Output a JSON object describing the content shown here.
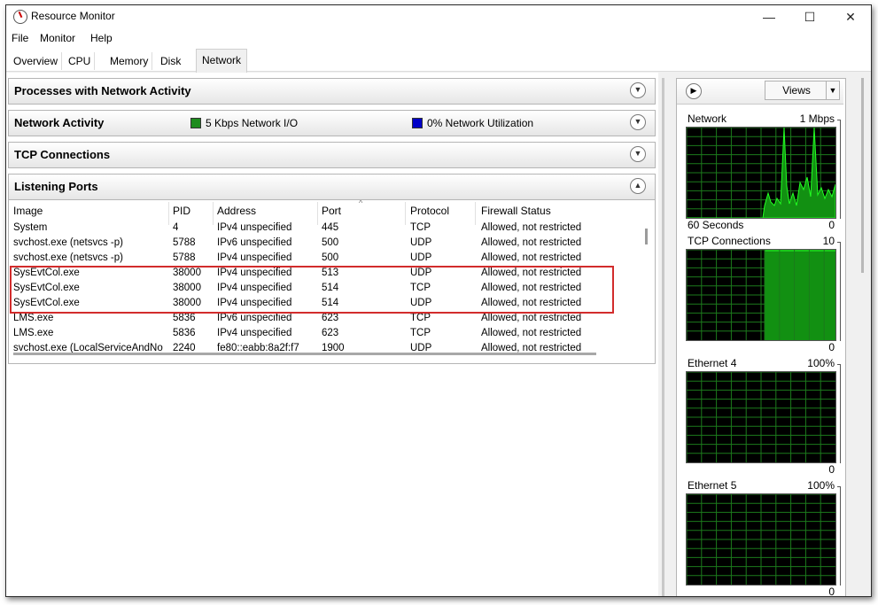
{
  "window": {
    "title": "Resource Monitor",
    "minimize": "—",
    "maximize": "☐",
    "close": "✕"
  },
  "menu": [
    "File",
    "Monitor",
    "Help"
  ],
  "tabs": [
    "Overview",
    "CPU",
    "Memory",
    "Disk",
    "Network"
  ],
  "active_tab": "Network",
  "sections": {
    "processes": {
      "title": "Processes with Network Activity"
    },
    "network_activity": {
      "title": "Network Activity",
      "io_label": "5 Kbps Network I/O",
      "io_color": "#1e8c1e",
      "util_label": "0% Network Utilization",
      "util_color": "#0000c8"
    },
    "tcp": {
      "title": "TCP Connections"
    },
    "listening": {
      "title": "Listening Ports"
    }
  },
  "listening_ports": {
    "columns": [
      "Image",
      "PID",
      "Address",
      "Port",
      "Protocol",
      "Firewall Status"
    ],
    "rows": [
      [
        "System",
        "4",
        "IPv4 unspecified",
        "445",
        "TCP",
        "Allowed, not restricted"
      ],
      [
        "svchost.exe (netsvcs -p)",
        "5788",
        "IPv6 unspecified",
        "500",
        "UDP",
        "Allowed, not restricted"
      ],
      [
        "svchost.exe (netsvcs -p)",
        "5788",
        "IPv4 unspecified",
        "500",
        "UDP",
        "Allowed, not restricted"
      ],
      [
        "SysEvtCol.exe",
        "38000",
        "IPv4 unspecified",
        "513",
        "UDP",
        "Allowed, not restricted"
      ],
      [
        "SysEvtCol.exe",
        "38000",
        "IPv4 unspecified",
        "514",
        "TCP",
        "Allowed, not restricted"
      ],
      [
        "SysEvtCol.exe",
        "38000",
        "IPv4 unspecified",
        "514",
        "UDP",
        "Allowed, not restricted"
      ],
      [
        "LMS.exe",
        "5836",
        "IPv6 unspecified",
        "623",
        "TCP",
        "Allowed, not restricted"
      ],
      [
        "LMS.exe",
        "5836",
        "IPv4 unspecified",
        "623",
        "TCP",
        "Allowed, not restricted"
      ],
      [
        "svchost.exe (LocalServiceAndNo",
        "2240",
        "fe80::eabb:8a2f:f7",
        "1900",
        "UDP",
        "Allowed, not restricted"
      ]
    ],
    "highlight_color": "#d22c2c"
  },
  "views_panel": {
    "views_label": "Views",
    "graphs": [
      {
        "name": "Network",
        "scale": "1 Mbps",
        "bottom_left": "60 Seconds",
        "bottom_right": "0"
      },
      {
        "name": "TCP Connections",
        "scale": "10",
        "bottom_left": "",
        "bottom_right": "0"
      },
      {
        "name": "Ethernet 4",
        "scale": "100%",
        "bottom_left": "",
        "bottom_right": "0"
      },
      {
        "name": "Ethernet 5",
        "scale": "100%",
        "bottom_left": "",
        "bottom_right": "0"
      }
    ],
    "grid_color": "#1c7a1c",
    "line_color": "#22ff22",
    "fill_color": "#129012"
  }
}
